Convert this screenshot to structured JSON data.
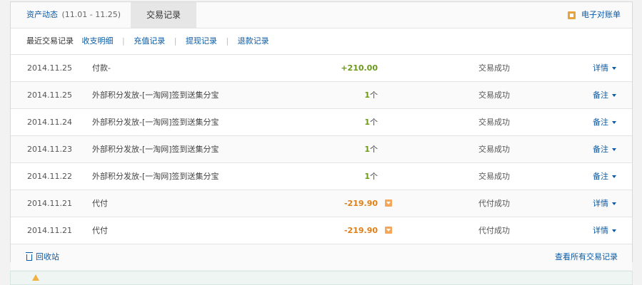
{
  "tabs": {
    "assets_label": "资产动态",
    "assets_range": "(11.01 - 11.25)",
    "trade_label": "交易记录",
    "ebill_label": "电子对账单"
  },
  "subnav": {
    "current": "最近交易记录",
    "links": [
      "收支明细",
      "充值记录",
      "提现记录",
      "退款记录"
    ]
  },
  "rows": [
    {
      "date": "2014.11.25",
      "name": "付款-",
      "amount": "+210.00",
      "unit": "",
      "status": "交易成功",
      "action": "详情"
    },
    {
      "date": "2014.11.25",
      "name": "外部积分发放-[一淘网]签到送集分宝",
      "amount": "1",
      "unit": "个",
      "status": "交易成功",
      "action": "备注"
    },
    {
      "date": "2014.11.24",
      "name": "外部积分发放-[一淘网]签到送集分宝",
      "amount": "1",
      "unit": "个",
      "status": "交易成功",
      "action": "备注"
    },
    {
      "date": "2014.11.23",
      "name": "外部积分发放-[一淘网]签到送集分宝",
      "amount": "1",
      "unit": "个",
      "status": "交易成功",
      "action": "备注"
    },
    {
      "date": "2014.11.22",
      "name": "外部积分发放-[一淘网]签到送集分宝",
      "amount": "1",
      "unit": "个",
      "status": "交易成功",
      "action": "备注"
    },
    {
      "date": "2014.11.21",
      "name": "代付",
      "amount": "-219.90",
      "unit": "",
      "status": "代付成功",
      "action": "详情"
    },
    {
      "date": "2014.11.21",
      "name": "代付",
      "amount": "-219.90",
      "unit": "",
      "status": "代付成功",
      "action": "详情"
    }
  ],
  "footer": {
    "recycle_label": "回收站",
    "view_all_label": "查看所有交易记录"
  },
  "colors": {
    "link": "#0a5aa5",
    "positive": "#6b9a1a",
    "negative": "#e07f16"
  },
  "icons": {
    "ebill": "bill-icon",
    "amount_dropdown": "dropdown-icon",
    "recycle": "trash-icon",
    "notice": "warning-icon"
  }
}
